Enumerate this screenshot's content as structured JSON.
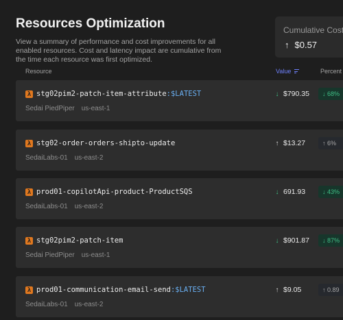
{
  "page": {
    "title": "Resources Optimization",
    "description": "View a summary of performance and cost improvements for all enabled resources. Cost and latency impact are cumulative from the time each resource was first optimized."
  },
  "cumulative": {
    "label": "Cumulative Cost",
    "value": "$0.57",
    "direction": "up"
  },
  "table": {
    "headers": {
      "resource": "Resource",
      "value": "Value",
      "percent": "Percent"
    },
    "rows": [
      {
        "name": "stg02pim2-patch-item-attribute",
        "version": ":$LATEST",
        "account": "Sedai PiedPiper",
        "region": "us-east-1",
        "value": "$790.35",
        "direction": "down",
        "percent": "68%",
        "badge": "green"
      },
      {
        "name": "stg02-order-orders-shipto-update",
        "version": "",
        "account": "SedaiLabs-01",
        "region": "us-east-2",
        "value": "$13.27",
        "direction": "up",
        "percent": "6%",
        "badge": "neutral"
      },
      {
        "name": "prod01-copilotApi-product-ProductSQS",
        "version": "",
        "account": "SedaiLabs-01",
        "region": "us-east-2",
        "value": "691.93",
        "direction": "down",
        "percent": "43%",
        "badge": "green"
      },
      {
        "name": "stg02pim2-patch-item",
        "version": "",
        "account": "Sedai PiedPiper",
        "region": "us-east-1",
        "value": "$901.87",
        "direction": "down",
        "percent": "87%",
        "badge": "green"
      },
      {
        "name": "prod01-communication-email-send",
        "version": ":$LATEST",
        "account": "SedaiLabs-01",
        "region": "us-east-2",
        "value": "$9.05",
        "direction": "up",
        "percent": "0.89",
        "badge": "neutral"
      }
    ]
  }
}
